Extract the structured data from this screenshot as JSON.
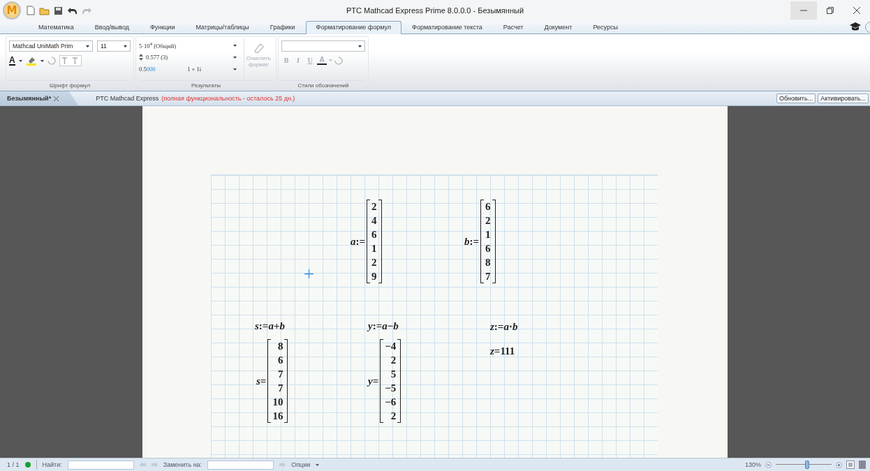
{
  "window": {
    "logo": "M",
    "title": "PTC Mathcad Express Prime 8.0.0.0 - Безымянный"
  },
  "tabs": [
    {
      "label": "Математика",
      "selected": false
    },
    {
      "label": "Ввод/вывод",
      "selected": false
    },
    {
      "label": "Функции",
      "selected": false
    },
    {
      "label": "Матрицы/таблицы",
      "selected": false
    },
    {
      "label": "Графики",
      "selected": false
    },
    {
      "label": "Форматирование формул",
      "selected": true
    },
    {
      "label": "Форматирование текста",
      "selected": false
    },
    {
      "label": "Расчет",
      "selected": false
    },
    {
      "label": "Документ",
      "selected": false
    },
    {
      "label": "Ресурсы",
      "selected": false
    }
  ],
  "formula_font": {
    "font": "Mathcad UniMath Prim",
    "size": "11",
    "color_letter": "A",
    "caption": "Шрифт формул"
  },
  "results": {
    "format": "5·10$^{4}$ (Общий)",
    "precision": "0.577 (3)",
    "sample": "0.5",
    "sample_extra": "000",
    "complex": "1 + 1i",
    "clear_format": {
      "label": "Очистить формат",
      "disabled": true
    },
    "caption": "Результаты"
  },
  "label_styles": {
    "buttons": [
      {
        "label": "B",
        "disabled": true
      },
      {
        "label": "I",
        "disabled": true
      },
      {
        "label": "U",
        "disabled": true
      },
      {
        "label": "A",
        "disabled": true
      }
    ],
    "caption": "Стили обозначений"
  },
  "doc_tabs": [
    {
      "label": "Безымянный*",
      "selected": true
    }
  ],
  "notice": {
    "product": "PTC Mathcad Express",
    "warning": "(полная функциональность - осталось 25 дн.)"
  },
  "doc_buttons": [
    "Обновить...",
    "Активировать..."
  ],
  "worksheet": [
    {
      "kind": "matrix",
      "lhs": "*a*:=",
      "values": [
        "2",
        "4",
        "6",
        "1",
        "2",
        "9"
      ]
    },
    {
      "kind": "matrix",
      "lhs": "*b*:=",
      "values": [
        "6",
        "2",
        "1",
        "6",
        "8",
        "7"
      ]
    },
    {
      "kind": "expression",
      "text": "*s*:=*a*+*b*"
    },
    {
      "kind": "expression",
      "text": "*y*:=*a*−*b*"
    },
    {
      "kind": "expression",
      "text": "*z*:=*a*⋅*b*"
    },
    {
      "kind": "matrix",
      "lhs": "*s*=",
      "values": [
        "8",
        "6",
        "7",
        "7",
        "10",
        "16"
      ]
    },
    {
      "kind": "matrix",
      "lhs": "*y*=",
      "values": [
        "−4",
        "2",
        "5",
        "−5",
        "−6",
        "2"
      ]
    },
    {
      "kind": "expression",
      "text": "*z*=111"
    }
  ],
  "status_bar": {
    "page": "1 / 1",
    "find_label": "Найти:",
    "replace_label": "Заменить на:",
    "options": "Опции",
    "zoom": {
      "reading": "130%",
      "level": 0.56
    }
  }
}
